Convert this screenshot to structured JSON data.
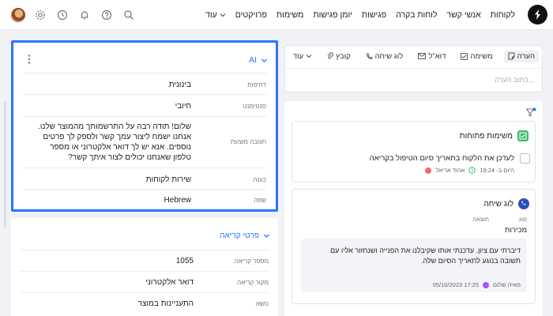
{
  "nav": {
    "items": [
      "לקוחות",
      "אנשי קשר",
      "לוחות בקרה",
      "פגישות",
      "יומן פגישות",
      "משימות",
      "פרויקטים"
    ],
    "more": "עוד"
  },
  "ai": {
    "title": "AI",
    "rows": [
      {
        "label": "דחיפות",
        "value": "בינונית"
      },
      {
        "label": "סנטימנט",
        "value": "חיובי"
      },
      {
        "label": "תגובה מוצעת",
        "value": "שלום! תודה רבה על התרשמותך מהמוצר שלנו. אנחנו ישמח ליצור עמך קשר ולספק לך פרטים נוספים. אנא יש לך דואר אלקטרוני או מספר טלפון שאנחנו יכולים לצור איתך קשר?"
      },
      {
        "label": "כוונה",
        "value": "שירות לקוחות"
      },
      {
        "label": "שפה",
        "value": "Hebrew"
      }
    ]
  },
  "details": {
    "title": "פרטי קריאה",
    "rows": [
      {
        "label": "מספר קריאה",
        "value": "1055"
      },
      {
        "label": "מקור קריאה",
        "value": "דואר אלקטרוני"
      },
      {
        "label": "נושא",
        "value": "התעניינות במוצר"
      }
    ]
  },
  "compose": {
    "tabs": [
      "הערה",
      "משימה",
      "דוא\"ל",
      "לוג שיחה",
      "קובץ",
      "עוד"
    ],
    "placeholder": "כתוב הערה..."
  },
  "tasks": {
    "title": "משימות פתוחות",
    "item_text": "לעדכן את הלקוח בתאריך סיום הטיפול בקריאה",
    "assignee": "אהוד אריאל",
    "due": "היום ב- 19:24"
  },
  "call": {
    "title": "לוג שיחה",
    "type_label": "סוג",
    "result_label": "תוצאה",
    "type_value": "מכירות",
    "note": "דיברתי עם ציון. עדכנתי אותו שקיבלנו את הפנייה ושנחזור אליו עם תשובה בנוגע לתאריך הסיום שלה.",
    "author": "מאיה שלום",
    "timestamp": "05/10/2023 17:25"
  },
  "colors": {
    "accent": "#2d74ff",
    "highlight_border": "#2d74ff",
    "tasks_icon": "#3cbc6d",
    "call_icon": "#2d4fb8"
  }
}
